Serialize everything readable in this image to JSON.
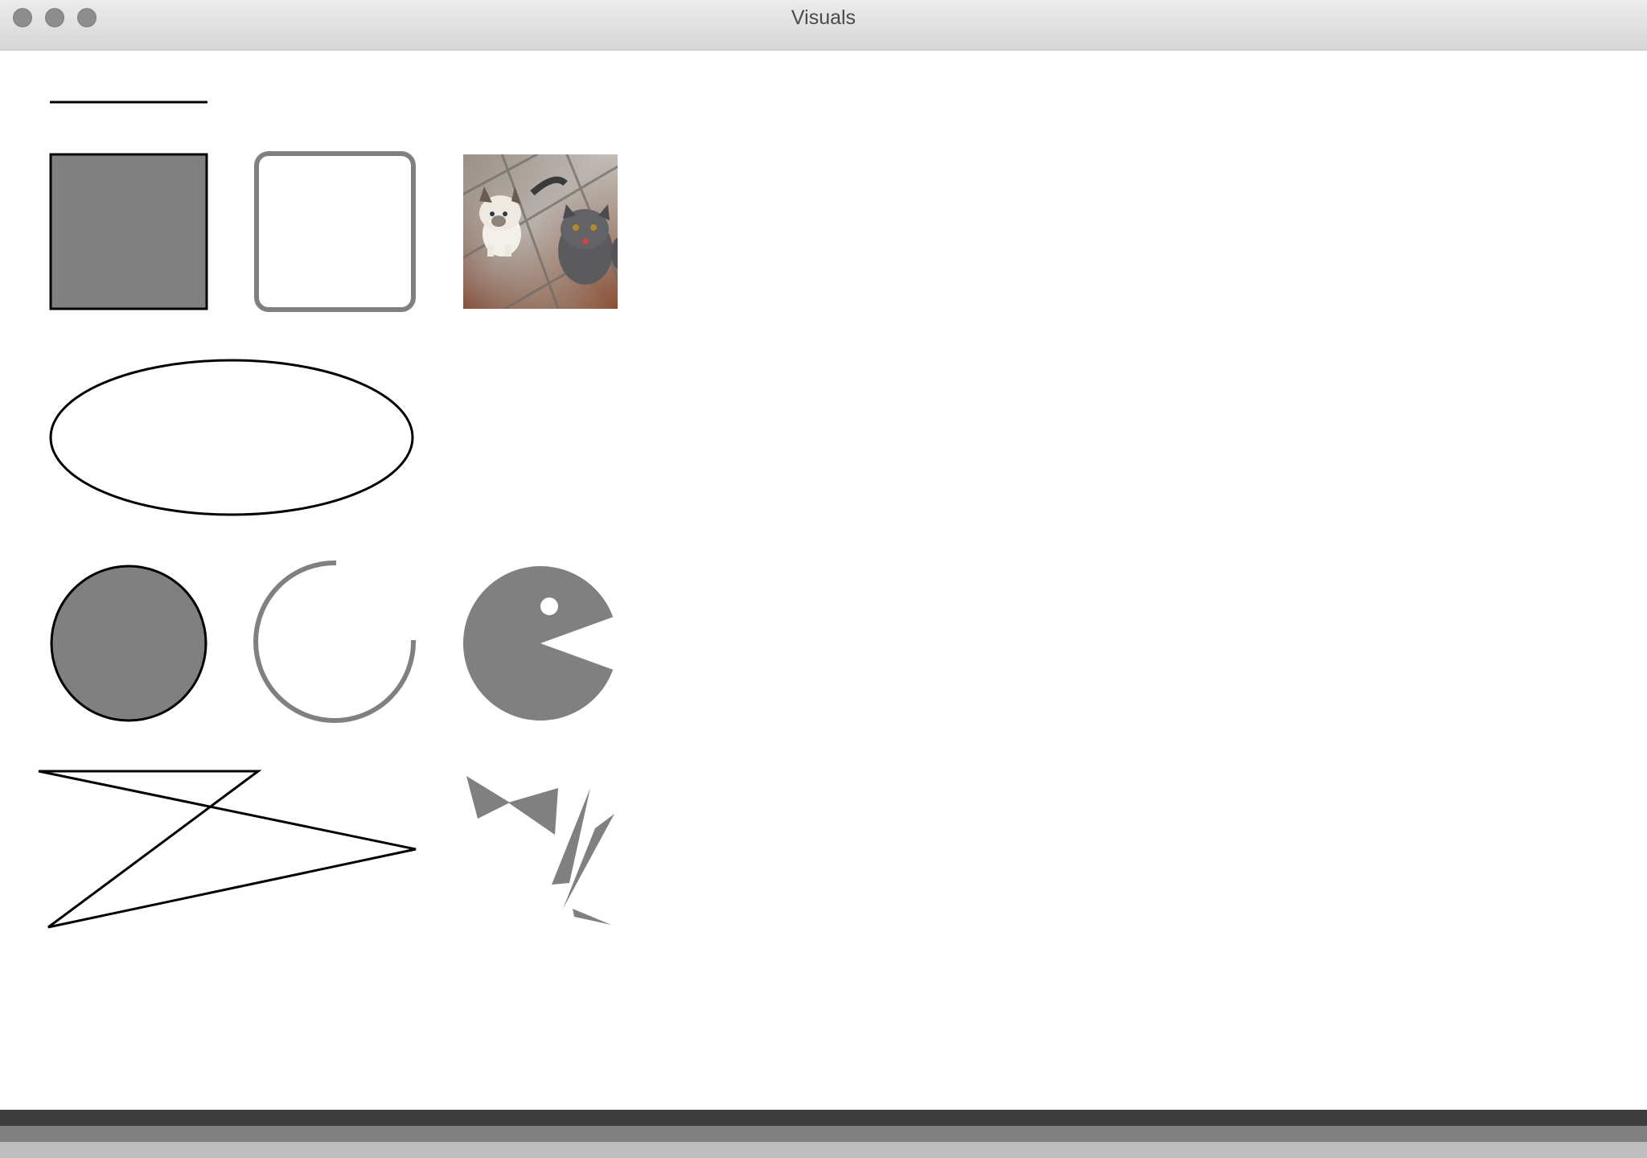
{
  "window": {
    "title": "Visuals",
    "controls": [
      "close",
      "minimize",
      "zoom"
    ]
  },
  "image": {
    "description": "two-kittens-on-tiled-floor"
  },
  "colors": {
    "shape_fill": "#808080",
    "stroke": "#000000",
    "footer": [
      "#3d3d3d",
      "#808080",
      "#bdbdbd"
    ]
  }
}
